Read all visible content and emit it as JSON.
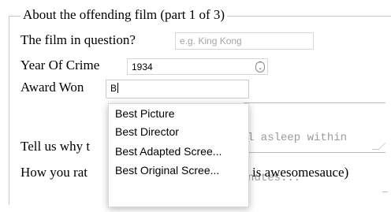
{
  "fieldset": {
    "legend": "About the offending film (part 1 of 3)"
  },
  "film": {
    "label": "The film in question?",
    "placeholder": "e.g. King Kong"
  },
  "year": {
    "label": "Year Of Crime",
    "value": "1934",
    "stepper_icon": "⌃⌄"
  },
  "award": {
    "label": "Award Won",
    "value": "B",
    "options": [
      "Best Picture",
      "Best Director",
      "Best Adapted Scree...",
      "Best Original Scree..."
    ]
  },
  "reason": {
    "label": "Tell us why t",
    "placeholder_line1": "l asleep within",
    "placeholder_line2": "nutes..."
  },
  "rating": {
    "label_left": "How you rat",
    "label_right": "is awesomesauce)"
  }
}
